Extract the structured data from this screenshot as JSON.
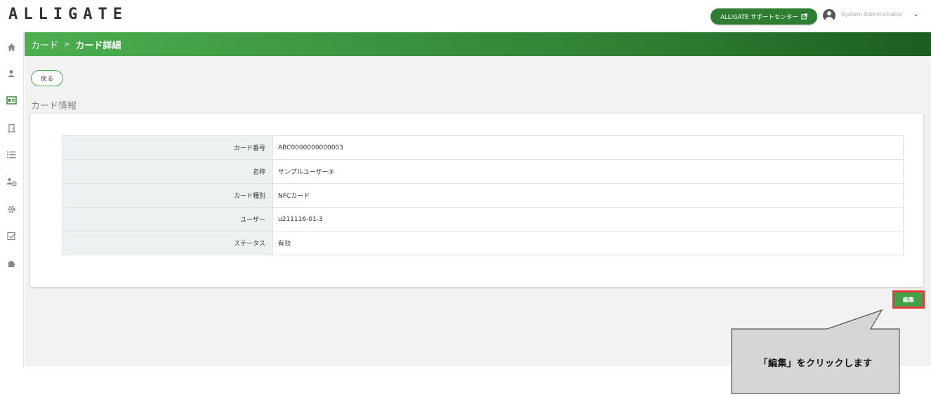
{
  "header": {
    "logo": "ALLIGATE",
    "support_label": "ALLIGATE サポートセンター",
    "support_icon": "external-link-icon",
    "user_name": "System Administrator",
    "chevron": "⌄"
  },
  "sidebar": {
    "items": [
      {
        "name": "home-icon",
        "glyph": "⌂"
      },
      {
        "name": "user-icon",
        "glyph": "●"
      },
      {
        "name": "card-icon",
        "glyph": "▣",
        "active": true
      },
      {
        "name": "door-icon",
        "glyph": "⊓"
      },
      {
        "name": "list-icon",
        "glyph": "☰"
      },
      {
        "name": "user-history-icon",
        "glyph": "◔"
      },
      {
        "name": "gear-icon",
        "glyph": "✲"
      },
      {
        "name": "checkbox-icon",
        "glyph": "☑"
      },
      {
        "name": "puzzle-icon",
        "glyph": "✤"
      }
    ]
  },
  "titlebar": {
    "parent": "カード",
    "separator": ">",
    "current": "カード詳細"
  },
  "main": {
    "back_label": "戻る",
    "section_title": "カード情報",
    "rows": [
      {
        "key": "カード番号",
        "value": "ABC0000000000003"
      },
      {
        "key": "名称",
        "value": "サンプルユーザー③"
      },
      {
        "key": "カード種別",
        "value": "NFCカード"
      },
      {
        "key": "ユーザー",
        "value": "u211116-01-3"
      },
      {
        "key": "ステータス",
        "value": "有効"
      }
    ],
    "edit_label": "編集"
  },
  "callout": {
    "text": "「編集」をクリックします"
  },
  "colors": {
    "accent": "#2e7d32",
    "highlight": "#e53935"
  }
}
